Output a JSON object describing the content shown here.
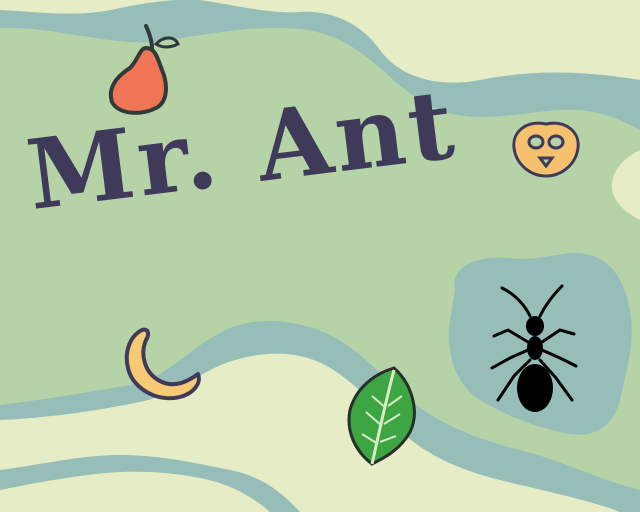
{
  "title": "Mr. Ant",
  "colors": {
    "meadow": "#b6d3a8",
    "river": "#96bdb7",
    "sand": "#e6edc6",
    "ink": "#3f3a59",
    "pear": "#f07556",
    "pretzel": "#f6c16e",
    "banana": "#f6c974",
    "leaf": "#3ea543",
    "ant": "#000000"
  },
  "sprites": {
    "pear": "pear-icon",
    "pretzel": "pretzel-icon",
    "banana": "banana-icon",
    "leaf": "leaf-icon",
    "ant": "ant-icon"
  }
}
